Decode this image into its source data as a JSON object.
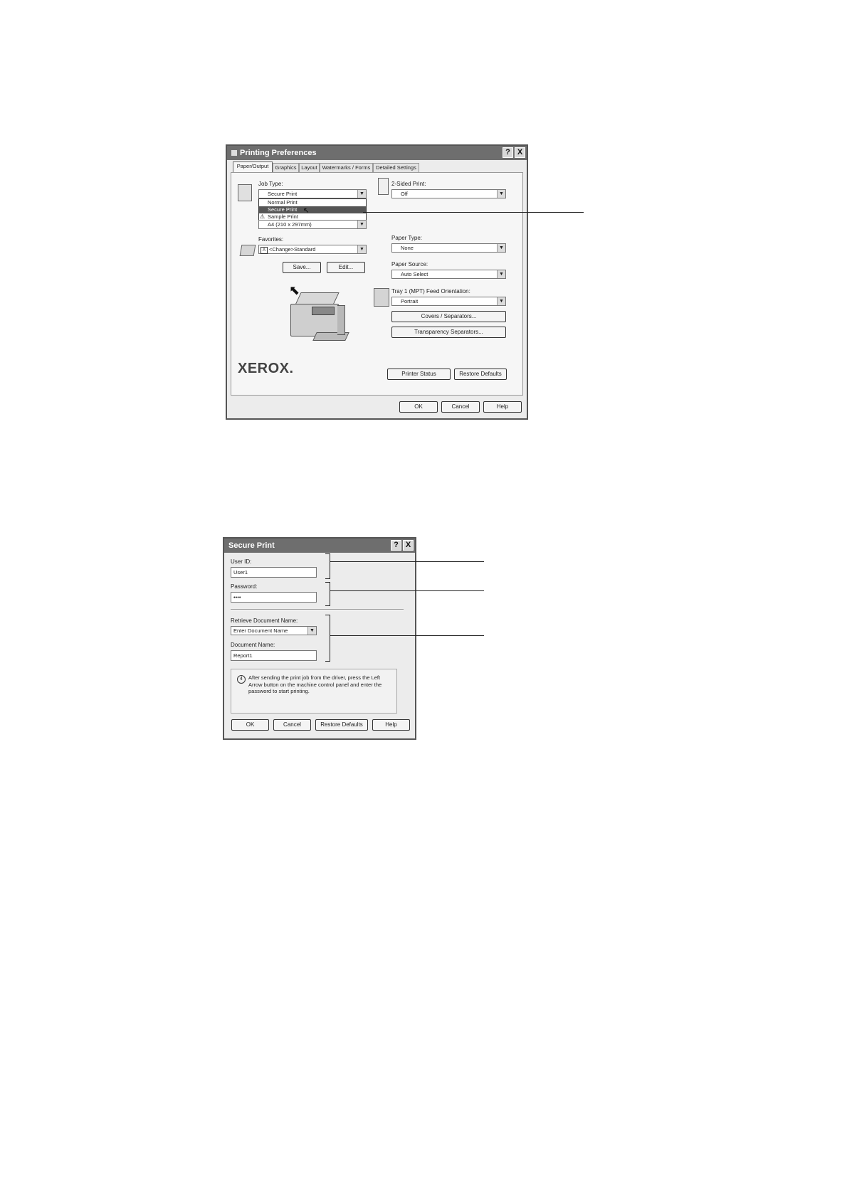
{
  "printing_preferences": {
    "title": "Printing Preferences",
    "help_btn": "?",
    "close_btn": "X",
    "tabs": [
      "Paper/Output",
      "Graphics",
      "Layout",
      "Watermarks / Forms",
      "Detailed Settings"
    ],
    "job_type_label": "Job Type:",
    "job_type_value": "Secure Print",
    "job_type_options": [
      "Normal Print",
      "Secure Print",
      "Sample Print"
    ],
    "paper_size_value": "A4 (210 x 297mm)",
    "favorites_label": "Favorites:",
    "favorites_value": "<Change>Standard",
    "favorites_badge": "A",
    "save_btn": "Save...",
    "edit_btn": "Edit...",
    "two_sided_label": "2-Sided Print:",
    "two_sided_value": "Off",
    "paper_type_label": "Paper Type:",
    "paper_type_value": "None",
    "paper_source_label": "Paper Source:",
    "paper_source_value": "Auto Select",
    "feed_orientation_label": "Tray 1 (MPT) Feed Orientation:",
    "feed_orientation_value": "Portrait",
    "covers_btn": "Covers / Separators...",
    "transparency_btn": "Transparency Separators...",
    "logo": "XEROX.",
    "printer_status_btn": "Printer Status",
    "restore_defaults_btn": "Restore Defaults",
    "ok_btn": "OK",
    "cancel_btn": "Cancel",
    "help_bottom_btn": "Help"
  },
  "secure_print": {
    "title": "Secure Print",
    "help_btn": "?",
    "close_btn": "X",
    "user_id_label": "User ID:",
    "user_id_value": "User1",
    "password_label": "Password:",
    "password_value": "••••",
    "retrieve_label": "Retrieve Document Name:",
    "retrieve_value": "Enter Document Name",
    "document_name_label": "Document Name:",
    "document_name_value": "Report1",
    "info_icon": "4",
    "info_text": "After sending the print job from the driver, press the Left Arrow button on the machine control panel and enter the password to start printing.",
    "ok_btn": "OK",
    "cancel_btn": "Cancel",
    "restore_defaults_btn": "Restore Defaults",
    "help_btn_bottom": "Help"
  }
}
